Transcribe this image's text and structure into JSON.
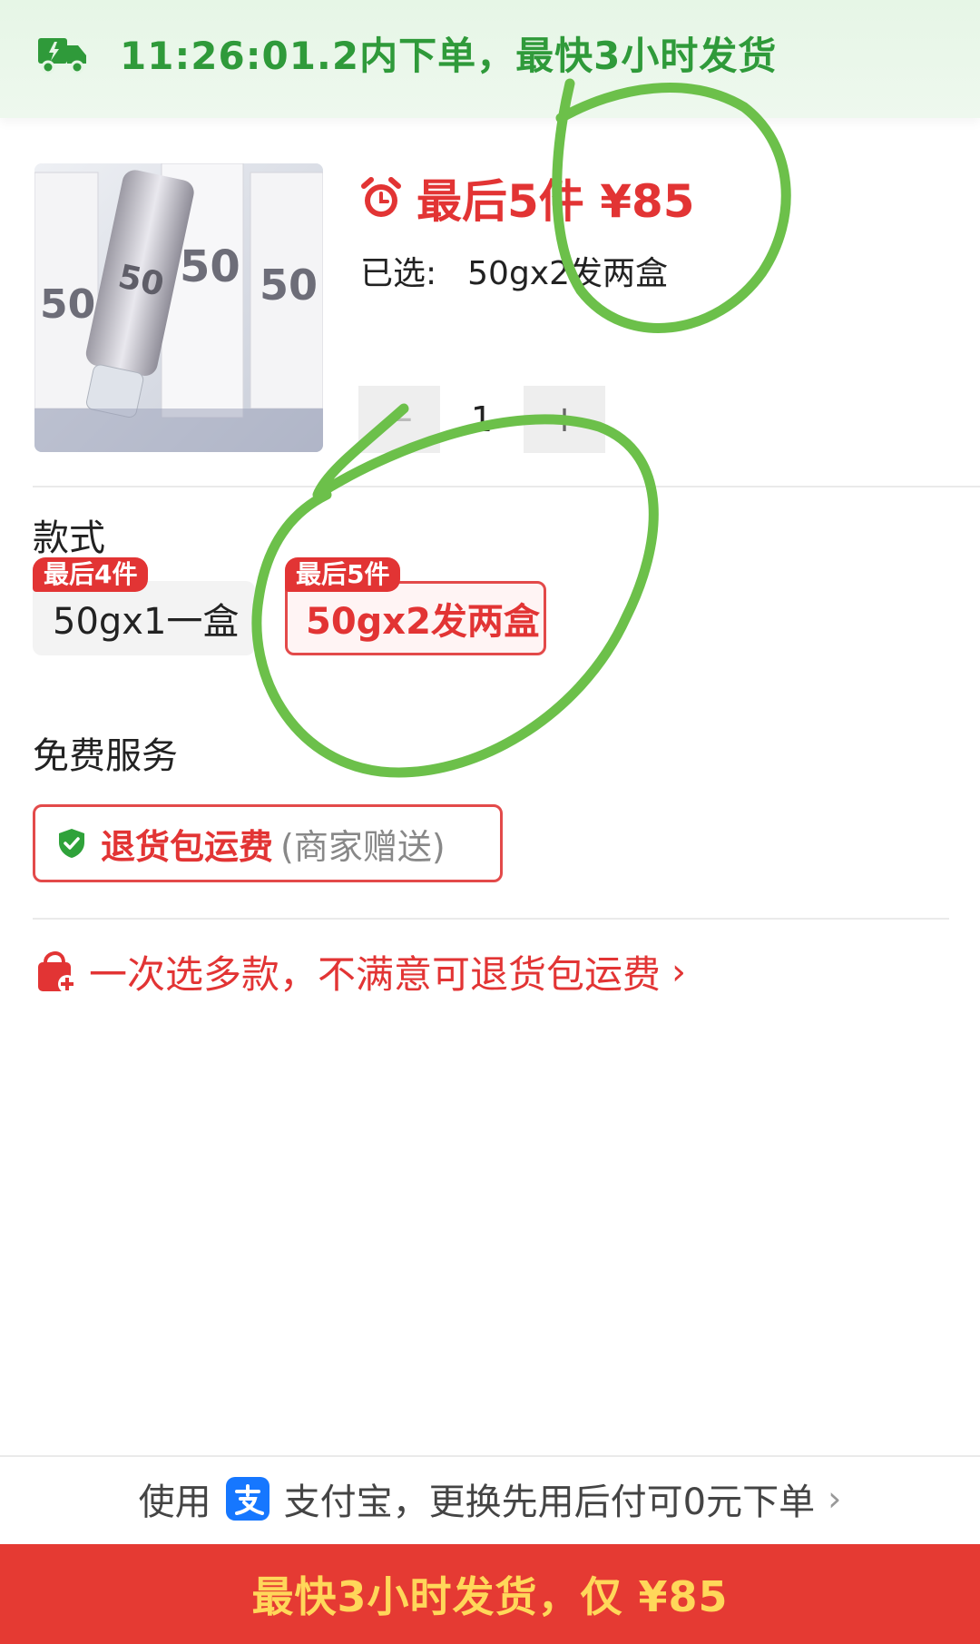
{
  "banner": {
    "text": "11:26:01.2内下单，最快3小时发货",
    "icon": "delivery-truck-icon",
    "color": "#2f9a3a"
  },
  "product": {
    "image_description": "product-photo",
    "price_text": "最后5件 ¥85",
    "selected_label": "已选:",
    "selected_value": "50gx2发两盒",
    "quantity": "1",
    "minus_label": "−",
    "plus_label": "+"
  },
  "style_section": {
    "title": "款式",
    "options": [
      {
        "tag": "最后4件",
        "label": "50gx1一盒",
        "selected": false
      },
      {
        "tag": "最后5件",
        "label": "50gx2发两盒",
        "selected": true
      }
    ]
  },
  "services": {
    "title": "免费服务",
    "item_main": "退货包运费",
    "item_sub": "(商家赠送)"
  },
  "promo": {
    "text": "一次选多款，不满意可退货包运费",
    "chevron": "›"
  },
  "pay_bar": {
    "prefix": "使用",
    "text": "支付宝，更换先用后付可0元下单",
    "chevron": "›"
  },
  "buy_button": {
    "label": "最快3小时发货，仅 ¥85"
  },
  "colors": {
    "accent_red": "#e23434",
    "banner_green": "#2f9a3a",
    "button_bg": "#e53a33",
    "button_text": "#ffd75a",
    "annotation_green": "#6cc04a"
  }
}
